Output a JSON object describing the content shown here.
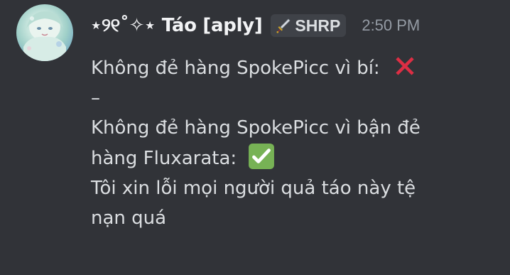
{
  "message": {
    "username": "⋆୨୧˚✧⋆ Táo [aply]",
    "tag": {
      "label": "SHRP",
      "icon": "sword-icon"
    },
    "timestamp": "2:50 PM",
    "lines": [
      "Không đẻ hàng SpokePicc vì bí:",
      "–",
      "Không đẻ hàng SpokePicc vì bận đẻ",
      "hàng Fluxarata:",
      "Tôi xin lỗi mọi người quả táo này tệ",
      "nạn quá"
    ],
    "emojis": {
      "cross": "cross-mark-emoji",
      "check": "check-mark-emoji"
    }
  },
  "colors": {
    "background": "#313338",
    "username": "#f2f3f5",
    "text": "#dbdee1",
    "timestamp": "#949ba4",
    "tag_bg": "#3f4248",
    "cross": "#dd2e44",
    "check": "#77b255"
  }
}
